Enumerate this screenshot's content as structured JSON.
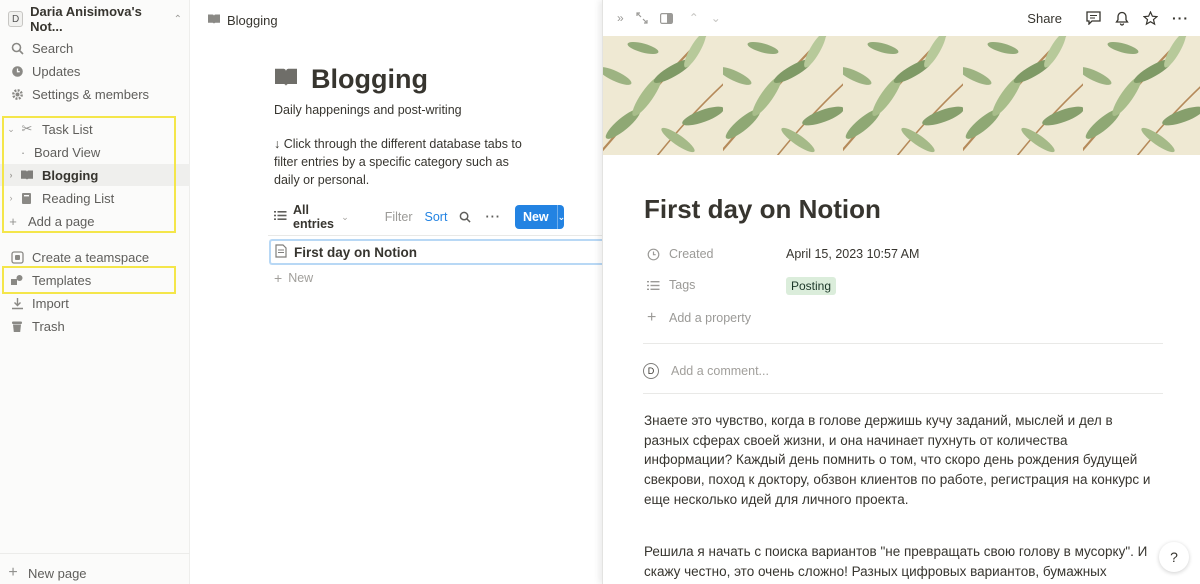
{
  "sidebar": {
    "workspace": {
      "avatar": "D",
      "name": "Daria Anisimova's Not..."
    },
    "top": [
      {
        "label": "Search",
        "icon": "search-icon"
      },
      {
        "label": "Updates",
        "icon": "clock-icon"
      },
      {
        "label": "Settings & members",
        "icon": "gear-icon"
      }
    ],
    "pages": [
      {
        "label": "Task List",
        "icon": "scissors-icon",
        "expanded": true
      },
      {
        "label": "Board View",
        "icon": "dot-icon"
      },
      {
        "label": "Blogging",
        "icon": "book-icon",
        "active": true
      },
      {
        "label": "Reading List",
        "icon": "book-stack-icon"
      },
      {
        "label": "Add a page",
        "icon": "plus-icon"
      }
    ],
    "bottom": [
      {
        "label": "Create a teamspace",
        "icon": "teamspace-icon"
      },
      {
        "label": "Templates",
        "icon": "shapes-icon"
      },
      {
        "label": "Import",
        "icon": "download-icon"
      },
      {
        "label": "Trash",
        "icon": "trash-icon"
      }
    ],
    "new_page": "New page",
    "highlight_color": "#f4e64a"
  },
  "main": {
    "breadcrumb": "Blogging",
    "title": "Blogging",
    "description": "Daily happenings and post-writing",
    "hint": "↓ Click through the different database tabs to filter entries by a specific category such as daily or personal.",
    "view_tab": "All entries",
    "filter": "Filter",
    "sort": "Sort",
    "new_button": "New",
    "rows": [
      {
        "title": "First day on Notion"
      }
    ],
    "new_row": "New",
    "accent": "#2383e2"
  },
  "peek": {
    "share": "Share",
    "title": "First day on Notion",
    "properties": [
      {
        "name": "Created",
        "icon": "clock-icon",
        "value": "April 15, 2023 10:57 AM"
      },
      {
        "name": "Tags",
        "icon": "list-icon",
        "value": "Posting"
      }
    ],
    "add_property": "Add a property",
    "comment_avatar": "D",
    "comment_placeholder": "Add a comment...",
    "paragraphs": [
      "Знаете это чувство, когда в голове держишь кучу заданий, мыслей и дел в разных сферах своей жизни, и она начинает пухнуть от количества информации? Каждый день помнить о том, что скоро день рождения будущей свекрови, поход к доктору, обзвон клиентов по работе, регистрация на конкурс и еще несколько идей для личного проекта.",
      "Решила я начать с поиска вариантов \"не превращать свою голову в мусорку\". И скажу честно, это очень сложно! Разных цифровых вариантов, бумажных планеров-"
    ],
    "help": "?",
    "tag_color": "#dbeddb"
  }
}
